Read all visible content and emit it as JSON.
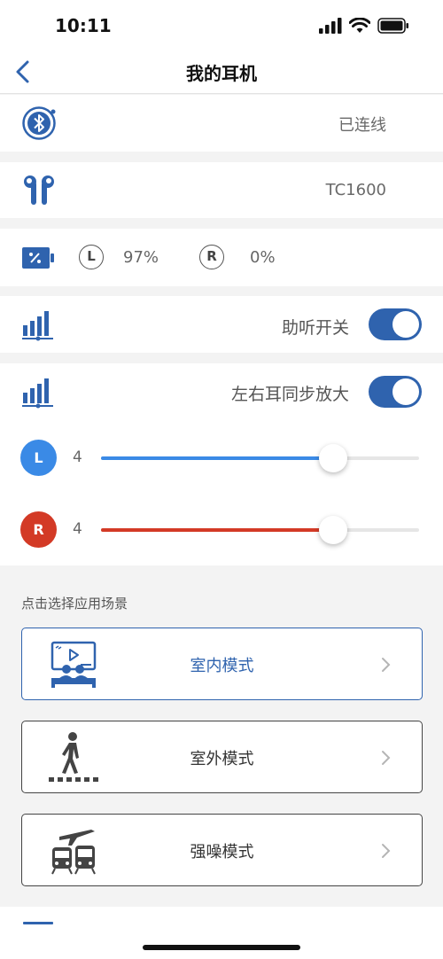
{
  "status": {
    "time": "10:11"
  },
  "nav": {
    "title": "我的耳机"
  },
  "device": {
    "connection_status": "已连线",
    "model": "TC1600"
  },
  "battery": {
    "left_label": "L",
    "left_value": "97%",
    "left_level": 0.97,
    "right_label": "R",
    "right_value": "0%",
    "right_level": 0.0
  },
  "hearing_aid": {
    "label": "助听开关",
    "on": true
  },
  "sync_amplify": {
    "label": "左右耳同步放大",
    "on": true
  },
  "channels": {
    "left": {
      "badge": "L",
      "value": "4",
      "level": 0.73,
      "color": "#3a8ae6"
    },
    "right": {
      "badge": "R",
      "value": "4",
      "level": 0.73,
      "color": "#d33a26"
    }
  },
  "scenes": {
    "section_label": "点击选择应用场景",
    "items": [
      {
        "label": "室内模式",
        "icon": "indoor-cinema-icon",
        "active": true
      },
      {
        "label": "室外模式",
        "icon": "pedestrian-icon",
        "active": false
      },
      {
        "label": "强噪模式",
        "icon": "train-airplane-icon",
        "active": false
      }
    ]
  },
  "colors": {
    "accent": "#2f63ae",
    "left": "#3a8ae6",
    "right": "#d33a26"
  }
}
